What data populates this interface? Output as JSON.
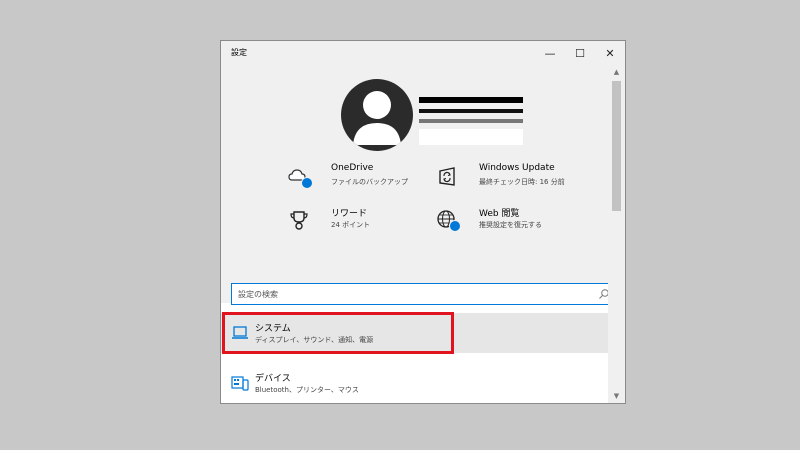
{
  "window": {
    "title": "設定",
    "minimize_glyph": "—",
    "maximize_glyph": "☐",
    "close_glyph": "✕"
  },
  "header": {
    "tiles": [
      {
        "name": "OneDrive",
        "description": "ファイルのバックアップ",
        "icon": "onedrive-cloud-icon"
      },
      {
        "name": "リワード",
        "description": "24 ポイント",
        "icon": "trophy-icon"
      },
      {
        "name": "Windows Update",
        "description": "最終チェック日時: 16 分前",
        "icon": "windows-update-icon"
      },
      {
        "name": "Web 閲覧",
        "description": "推奨設定を復元する",
        "icon": "globe-icon"
      }
    ]
  },
  "search": {
    "placeholder": "設定の検索"
  },
  "categories": [
    {
      "name": "システム",
      "description": "ディスプレイ、サウンド、通知、電源",
      "icon": "laptop-icon"
    },
    {
      "name": "デバイス",
      "description": "Bluetooth、プリンター、マウス",
      "icon": "devices-icon"
    }
  ],
  "colors": {
    "accent": "#0078d7",
    "highlight_border": "#e0141e",
    "header_bg": "#f0f0f0"
  }
}
